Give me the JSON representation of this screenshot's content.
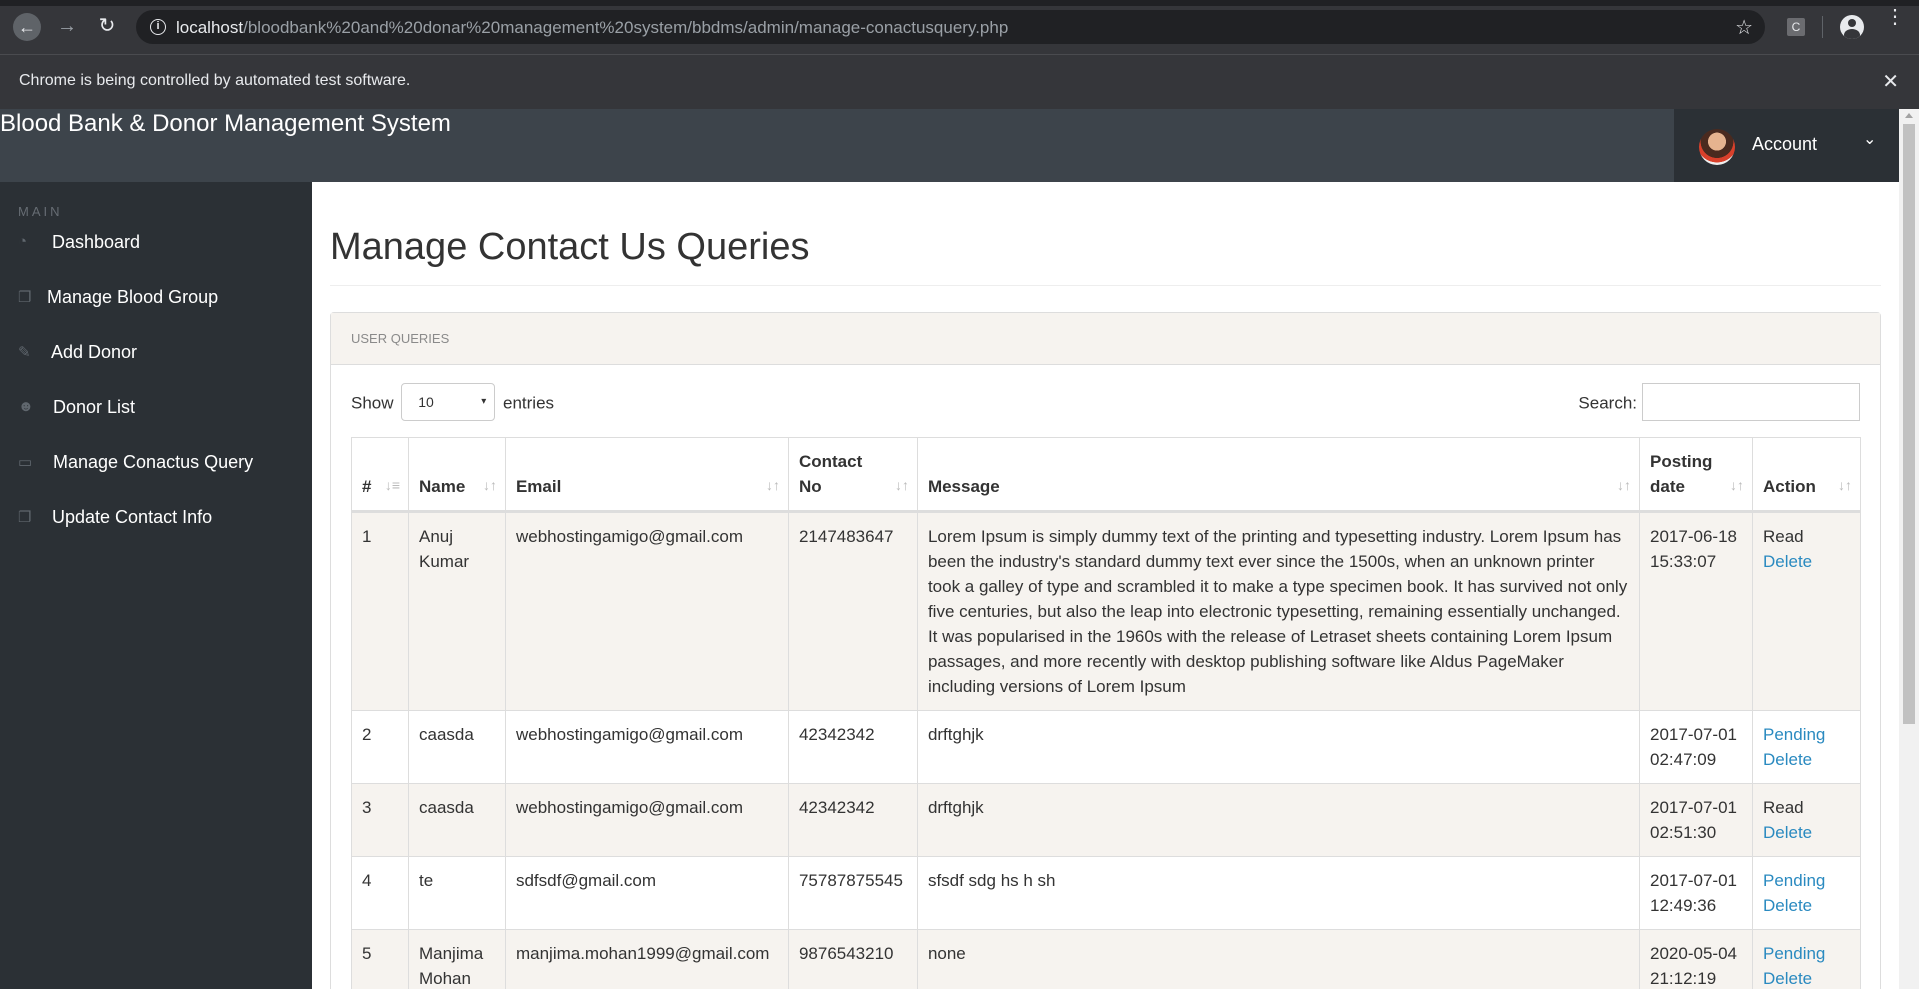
{
  "browser": {
    "url_host": "localhost",
    "url_path": "/bloodbank%20and%20donar%20management%20system/bbdms/admin/manage-conactusquery.php",
    "extension_label": "C",
    "automation_message": "Chrome is being controlled by automated test software."
  },
  "header": {
    "brand": "Blood Bank & Donor Management System",
    "account_label": "Account"
  },
  "sidebar": {
    "heading": "MAIN",
    "items": [
      {
        "label": "Dashboard",
        "icon": "dashboard-icon"
      },
      {
        "label": "Manage Blood Group",
        "icon": "copy-icon"
      },
      {
        "label": "Add Donor",
        "icon": "edit-icon"
      },
      {
        "label": "Donor List",
        "icon": "users-icon"
      },
      {
        "label": "Manage Conactus Query",
        "icon": "desktop-icon"
      },
      {
        "label": "Update Contact Info",
        "icon": "copy-icon"
      }
    ]
  },
  "main": {
    "title": "Manage Contact Us Queries",
    "panel_title": "USER QUERIES",
    "show_label": "Show",
    "entries_value": "10",
    "entries_label": "entries",
    "search_label": "Search:"
  },
  "table": {
    "headers": [
      "#",
      "Name",
      "Email",
      "Contact No",
      "Message",
      "Posting date",
      "Action"
    ],
    "rows": [
      {
        "num": "1",
        "name": "Anuj Kumar",
        "email": "webhostingamigo@gmail.com",
        "contact": "2147483647",
        "message": "Lorem Ipsum is simply dummy text of the printing and typesetting industry. Lorem Ipsum has been the industry's standard dummy text ever since the 1500s, when an unknown printer took a galley of type and scrambled it to make a type specimen book. It has survived not only five centuries, but also the leap into electronic typesetting, remaining essentially unchanged. It was popularised in the 1960s with the release of Letraset sheets containing Lorem Ipsum passages, and more recently with desktop publishing software like Aldus PageMaker including versions of Lorem Ipsum",
        "date": "2017-06-18 15:33:07",
        "status": "Read",
        "status_link": false,
        "delete": "Delete"
      },
      {
        "num": "2",
        "name": "caasda",
        "email": "webhostingamigo@gmail.com",
        "contact": "42342342",
        "message": "drftghjk",
        "date": "2017-07-01 02:47:09",
        "status": "Pending",
        "status_link": true,
        "delete": "Delete"
      },
      {
        "num": "3",
        "name": "caasda",
        "email": "webhostingamigo@gmail.com",
        "contact": "42342342",
        "message": "drftghjk",
        "date": "2017-07-01 02:51:30",
        "status": "Read",
        "status_link": false,
        "delete": "Delete"
      },
      {
        "num": "4",
        "name": "te",
        "email": "sdfsdf@gmail.com",
        "contact": "75787875545",
        "message": "sfsdf sdg hs h sh",
        "date": "2017-07-01 12:49:36",
        "status": "Pending",
        "status_link": true,
        "delete": "Delete"
      },
      {
        "num": "5",
        "name": "Manjima Mohan",
        "email": "manjima.mohan1999@gmail.com",
        "contact": "9876543210",
        "message": "none",
        "date": "2020-05-04 21:12:19",
        "status": "Pending",
        "status_link": true,
        "delete": "Delete"
      }
    ]
  },
  "colors": {
    "header_bg": "#3d444b",
    "sidebar_bg": "#2b3035",
    "link": "#2a8ac0",
    "stripe": "#f6f3ef"
  }
}
